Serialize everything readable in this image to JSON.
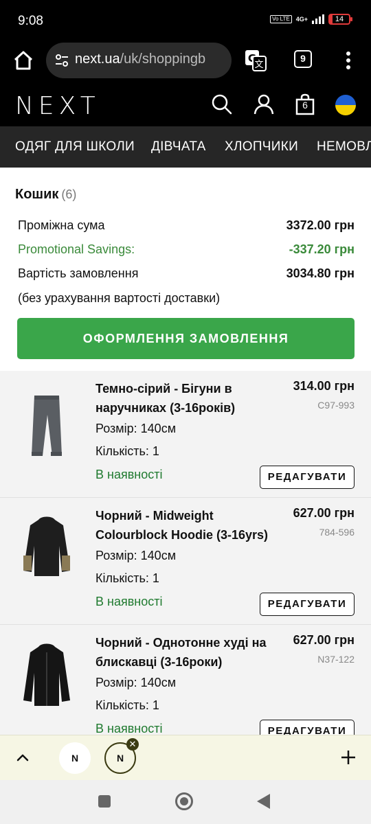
{
  "status_bar": {
    "time": "9:08",
    "network": "4G+",
    "volte": "Vo LTE",
    "battery": "14",
    "battery_level": 0.14
  },
  "browser": {
    "url_host": "next.ua",
    "url_path": "/uk/shoppingb",
    "tabs_count": "9"
  },
  "header": {
    "logo": "NEXT",
    "bag_count": "6"
  },
  "categories": [
    "ОДЯГ ДЛЯ ШКОЛИ",
    "ДІВЧАТА",
    "ХЛОПЧИКИ",
    "НЕМОВЛ"
  ],
  "basket": {
    "title": "Кошик",
    "count": "(6)",
    "subtotal_label": "Проміжна сума",
    "subtotal_value": "3372.00 грн",
    "promo_label": "Promotional Savings:",
    "promo_value": "-337.20 грн",
    "total_label": "Вартість замовлення",
    "total_value": "3034.80 грн",
    "delivery_note": "(без урахування вартості доставки)",
    "checkout_label": "ОФОРМЛЕННЯ ЗАМОВЛЕННЯ"
  },
  "items": [
    {
      "name": "Темно-сірий - Бігуни в наручниках (3-16років)",
      "price": "314.00 грн",
      "code": "C97-993",
      "size": "Розмір: 140см",
      "qty": "Кількість: 1",
      "stock": "В наявності",
      "edit": "РЕДАГУВАТИ"
    },
    {
      "name": "Чорний - Midweight Colourblock Hoodie (3-16yrs)",
      "price": "627.00 грн",
      "code": "784-596",
      "size": "Розмір: 140см",
      "qty": "Кількість: 1",
      "stock": "В наявності",
      "edit": "РЕДАГУВАТИ"
    },
    {
      "name": "Чорний - Однотонне худі на блискавці (3-16роки)",
      "price": "627.00 грн",
      "code": "N37-122",
      "size": "Розмір: 140см",
      "qty": "Кількість: 1",
      "stock": "В наявності",
      "edit": "РЕДАГУВАТИ"
    }
  ],
  "bottom_bar": {
    "tab1_letter": "N",
    "tab2_letter": "N"
  },
  "colors": {
    "accent_green": "#3aa64a",
    "stock_green": "#1f7a2f",
    "header_black": "#000000",
    "nav_grey": "#262626"
  }
}
